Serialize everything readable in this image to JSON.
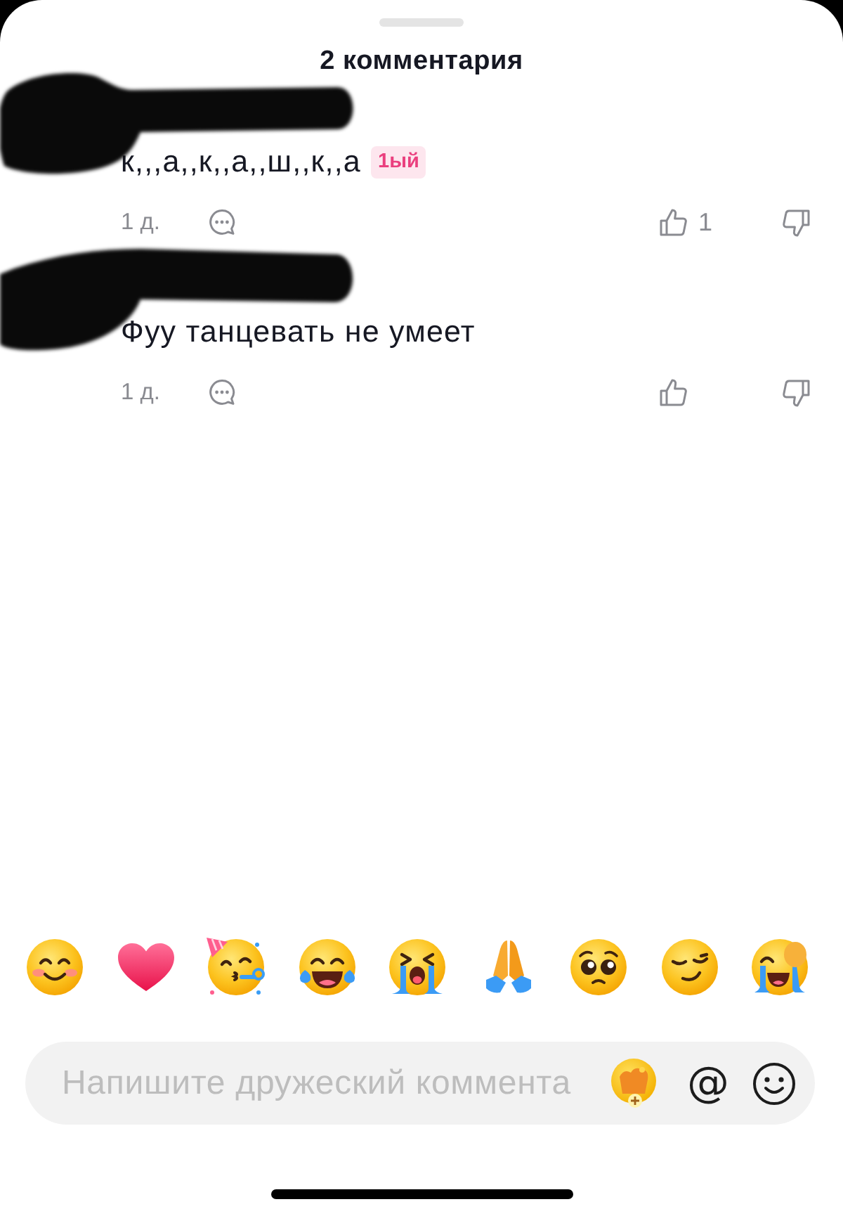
{
  "header": {
    "title": "2 комментария"
  },
  "comments": [
    {
      "author_redacted": true,
      "text": "к,,,а,,к,,а,,ш,,к,,а",
      "badge": "1ый",
      "time": "1 д.",
      "likes": "1"
    },
    {
      "author_redacted": true,
      "text": "Фуу танцевать не умеет",
      "time": "1 д."
    }
  ],
  "emoji_bar": {
    "items": [
      {
        "kind": "blush"
      },
      {
        "kind": "heart"
      },
      {
        "kind": "party"
      },
      {
        "kind": "joy"
      },
      {
        "kind": "sob"
      },
      {
        "kind": "pray"
      },
      {
        "kind": "pleading"
      },
      {
        "kind": "smirk"
      },
      {
        "kind": "tears"
      }
    ]
  },
  "composer": {
    "placeholder": "Напишите дружеский коммента",
    "mention": "@"
  }
}
